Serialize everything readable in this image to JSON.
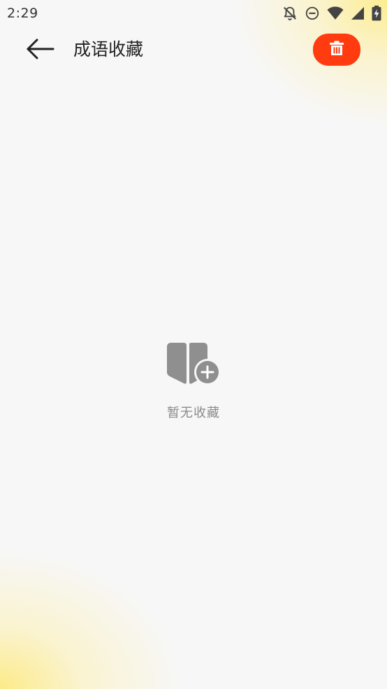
{
  "status_bar": {
    "time": "2:29",
    "icons": [
      "bell-off-icon",
      "do-not-disturb-icon",
      "wifi-icon",
      "signal-icon",
      "battery-charging-icon"
    ]
  },
  "app_bar": {
    "back_icon": "arrow-left-icon",
    "title": "成语收藏",
    "delete_icon": "trash-icon"
  },
  "empty_state": {
    "icon": "book-add-icon",
    "message": "暂无收藏"
  },
  "colors": {
    "accent": "#ff3b0f",
    "background": "#f7f7f7",
    "glow": "#fdea8a",
    "muted_text": "#8a8a8a",
    "icon_gray": "#8f8f8f"
  }
}
